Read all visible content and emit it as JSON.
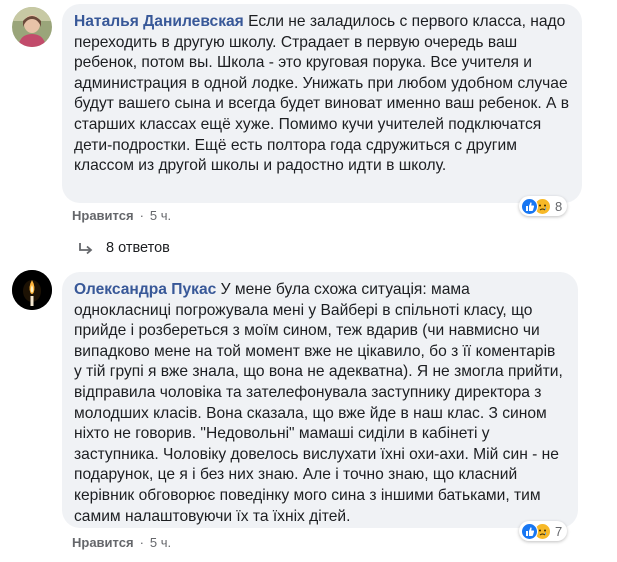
{
  "comments": [
    {
      "author": "Наталья Данилевская",
      "text": "Если не заладилось с первого класса, надо переходить в другую школу. Страдает в первую очередь ваш ребенок, потом вы. Школа - это круговая порука. Все учителя и администрация в одной лодке. Унижать при любом удобном случае будут вашего сына и всегда будет виноват именно ваш ребенок. А в старших классах ещё хуже. Помимо кучи учителей подключатся дети-подростки. Ещё есть полтора года сдружиться с другим классом из другой школы и радостно идти в школу.",
      "like_label": "Нравится",
      "separator": "·",
      "time": "5 ч.",
      "reaction_count": "8",
      "reactions": [
        "like-icon",
        "sad-icon"
      ]
    },
    {
      "author": "Олександра Пукас",
      "text": "У мене була схожа ситуація: мама однокласниці погрожувала мені у Вайбері в спільноті класу, що прийде і розбереться з моїм сином, теж вдарив (чи навмисно чи випадково мене на той момент вже не цікавило, бо з її коментарів у тій групі я вже знала, що вона не адекватна). Я не змогла прийти, відправила чоловіка та зателефонувала заступнику директора з молодших класів. Вона сказала, що вже йде в наш клас. З сином ніхто не говорив. \"Недовольні\" мамаші сиділи в кабінеті у заступника. Чоловіку довелось вислухати їхні охи-ахи. Мій син - не подарунок, це я і без них знаю. Але і точно знаю, що класний керівник обговорює поведінку мого сина з іншими батьками, тим самим налаштовуючи їх та їхніх дітей.",
      "like_label": "Нравится",
      "separator": "·",
      "time": "5 ч.",
      "reaction_count": "7",
      "reactions": [
        "like-icon",
        "sad-icon"
      ]
    }
  ],
  "replies_label": "8 ответов"
}
